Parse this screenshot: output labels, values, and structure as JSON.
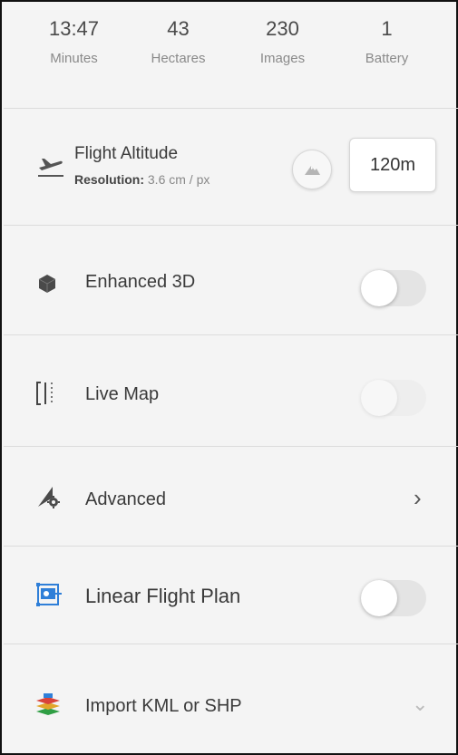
{
  "stats": [
    {
      "value": "13:47",
      "label": "Minutes"
    },
    {
      "value": "43",
      "label": "Hectares"
    },
    {
      "value": "230",
      "label": "Images"
    },
    {
      "value": "1",
      "label": "Battery"
    }
  ],
  "flight_altitude": {
    "title": "Flight Altitude",
    "resolution_label": "Resolution:",
    "resolution_value": "3.6 cm / px",
    "altitude_value": "120m",
    "icon": "takeoff-icon",
    "terrain_icon": "terrain-icon"
  },
  "enhanced_3d": {
    "label": "Enhanced 3D",
    "icon": "cube-icon",
    "enabled": false
  },
  "live_map": {
    "label": "Live Map",
    "icon": "live-map-icon",
    "enabled": false,
    "disabled": true
  },
  "advanced": {
    "label": "Advanced",
    "icon": "advanced-settings-icon",
    "chevron": "›"
  },
  "linear_flight_plan": {
    "label": "Linear Flight Plan",
    "icon": "linear-plan-icon",
    "enabled": false
  },
  "import": {
    "label": "Import KML or SHP",
    "icon": "layers-import-icon",
    "chevron": "⌄"
  },
  "colors": {
    "accent": "#2f7fd8",
    "background": "#f4f4f4",
    "divider": "#dcdcdc"
  }
}
